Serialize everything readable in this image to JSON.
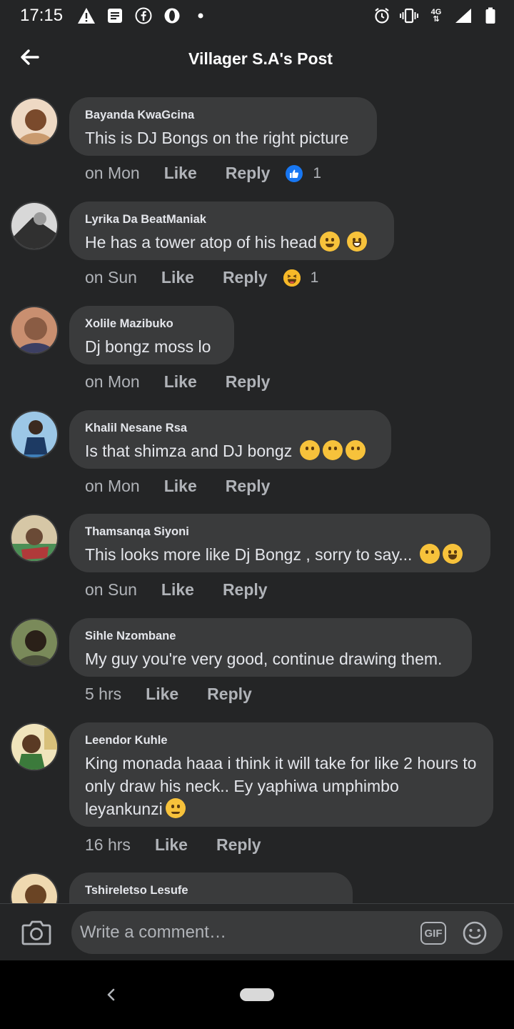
{
  "status_bar": {
    "time": "17:15",
    "left_icons": [
      "warning-icon",
      "message-icon",
      "facebook-icon",
      "opera-icon",
      "dot-icon"
    ],
    "right_icons": [
      "alarm-icon",
      "vibrate-icon",
      "network-4g-icon",
      "signal-icon",
      "battery-icon"
    ],
    "network_label": "4G"
  },
  "header": {
    "title": "Villager S.A's Post"
  },
  "comments": [
    {
      "author": "Bayanda KwaGcina",
      "text": "This is DJ Bongs on the right picture",
      "time": "on Mon",
      "like": "Like",
      "reply": "Reply",
      "reaction": "like",
      "reaction_count": "1",
      "avatar_colors": [
        "#c99a6e",
        "#7a4a2c",
        "#eed9c4"
      ]
    },
    {
      "author": "Lyrika Da BeatManiak",
      "text": "He has a tower atop of his head",
      "emojis": [
        "worried-face-emoji",
        "grinning-face-emoji"
      ],
      "time": "on Sun",
      "like": "Like",
      "reply": "Reply",
      "reaction": "haha",
      "reaction_count": "1",
      "avatar_colors": [
        "#9a9a9a",
        "#303030",
        "#d8d8d8"
      ]
    },
    {
      "author": "Xolile Mazibuko",
      "text": "Dj bongz moss lo",
      "time": "on Mon",
      "like": "Like",
      "reply": "Reply",
      "avatar_colors": [
        "#8a5c44",
        "#3c3f63",
        "#c98f70"
      ]
    },
    {
      "author": "Khalil Nesane Rsa",
      "text": "Is that shimza and DJ bongz",
      "emojis": [
        "thinking-face-emoji",
        "thinking-face-emoji",
        "thinking-face-emoji"
      ],
      "time": "on Mon",
      "like": "Like",
      "reply": "Reply",
      "avatar_colors": [
        "#3f7fb8",
        "#1d3a63",
        "#9cc7e6"
      ]
    },
    {
      "author": "Thamsanqa Siyoni",
      "text": "This looks more like Dj Bongz , sorry to say...",
      "emojis": [
        "thinking-face-emoji",
        "rofl-face-emoji"
      ],
      "time": "on Sun",
      "like": "Like",
      "reply": "Reply",
      "avatar_colors": [
        "#4c8f56",
        "#b03a3a",
        "#d6c7a6"
      ]
    },
    {
      "author": "Sihle Nzombane",
      "text": "My guy you're very good, continue drawing them.",
      "time": "5 hrs",
      "like": "Like",
      "reply": "Reply",
      "avatar_colors": [
        "#4a4f3a",
        "#2a2018",
        "#7a8a5a"
      ]
    },
    {
      "author": "Leendor Kuhle",
      "text": "King monada haaa i think it will take for like 2 hours to only draw his neck.. Ey yaphiwa umphimbo leyankunzi",
      "emojis": [
        "relieved-face-emoji"
      ],
      "time": "16 hrs",
      "like": "Like",
      "reply": "Reply",
      "avatar_colors": [
        "#d8c07a",
        "#3b7a3b",
        "#f0e4bc"
      ]
    },
    {
      "author": "Tshireletso Lesufe",
      "text": "",
      "avatar_colors": [
        "#c9a066",
        "#6a4424",
        "#efd9b0"
      ]
    }
  ],
  "composer": {
    "placeholder": "Write a comment…",
    "gif_label": "GIF"
  },
  "colors": {
    "background": "#242526",
    "bubble": "#3a3b3c",
    "text": "#e4e6eb",
    "secondary_text": "#b0b3b8",
    "like_blue": "#1877f2",
    "nav_bar": "#000000"
  }
}
